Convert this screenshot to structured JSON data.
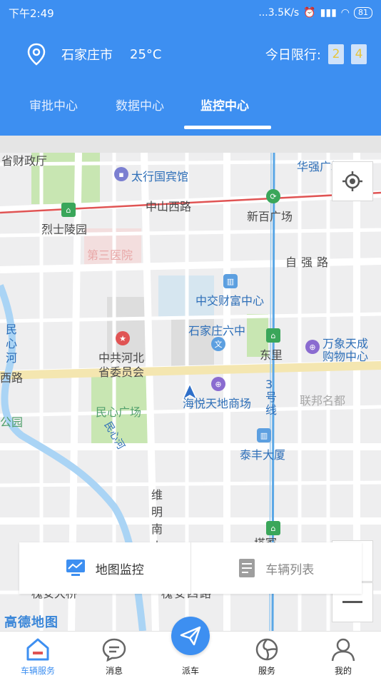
{
  "status": {
    "time": "下午2:49",
    "network_speed": "...3.5K/s",
    "battery": "81"
  },
  "location": {
    "city": "石家庄市",
    "temperature": "25°C",
    "limit_label": "今日限行:",
    "limit_numbers": [
      "2",
      "4"
    ]
  },
  "tabs": [
    {
      "label": "审批中心"
    },
    {
      "label": "数据中心"
    },
    {
      "label": "监控中心"
    }
  ],
  "active_tab": "监控中心",
  "map": {
    "labels": {
      "shengcaizhengting": "省财政厅",
      "taixingbinguan": "太行国宾馆",
      "huaqiangguangchang": "华强广场",
      "zhongshanxilu": "中山西路",
      "xinbaiguangchang": "新百广场",
      "lieshilingyuan": "烈士陵园",
      "disanyiyuan": "第三医院",
      "ziqianglu": "自强路",
      "zhongjiaocaifuzhongxin": "中交财富中心",
      "shijiazhuangliuzhong": "石家庄六中",
      "wanxiangtiancheng_1": "万象天成",
      "wanxiangtiancheng_2": "购物中心",
      "minxinhe_1": "民",
      "minxinhe_2": "心",
      "minxinhe_3": "河",
      "zhonggongshengwei_1": "中共河北",
      "zhonggongshengwei_2": "省委员会",
      "dongli": "东里",
      "xilu": "西路",
      "haiyuetiandishangchang": "海悦天地商场",
      "lianbangmingdu": "联邦名都",
      "minxinguangchang": "民心广场",
      "gongyuan": "公园",
      "line3": "3号线",
      "minxinhe_river": "民心河",
      "taifengdasha": "泰丰大厦",
      "weiming": "维明南大",
      "huaianxilu": "槐安四路",
      "huaiandaqiao": "槐安大桥",
      "station_partial": "塔冢"
    },
    "tab_monitor": "地图监控",
    "tab_vehicle_list": "车辆列表",
    "map_logo": "高德地图"
  },
  "bottom_nav": [
    {
      "label": "车辆服务",
      "active": true
    },
    {
      "label": "消息",
      "active": false
    },
    {
      "label": "派车",
      "active": false
    },
    {
      "label": "服务",
      "active": false
    },
    {
      "label": "我的",
      "active": false
    }
  ],
  "colors": {
    "primary": "#3d8ff1",
    "plate_text": "#e7c53b",
    "map_bg": "#eeeeef",
    "green_area": "#c8e6b2",
    "metro_line": "#5aa7e6",
    "red_line": "#e05454"
  }
}
